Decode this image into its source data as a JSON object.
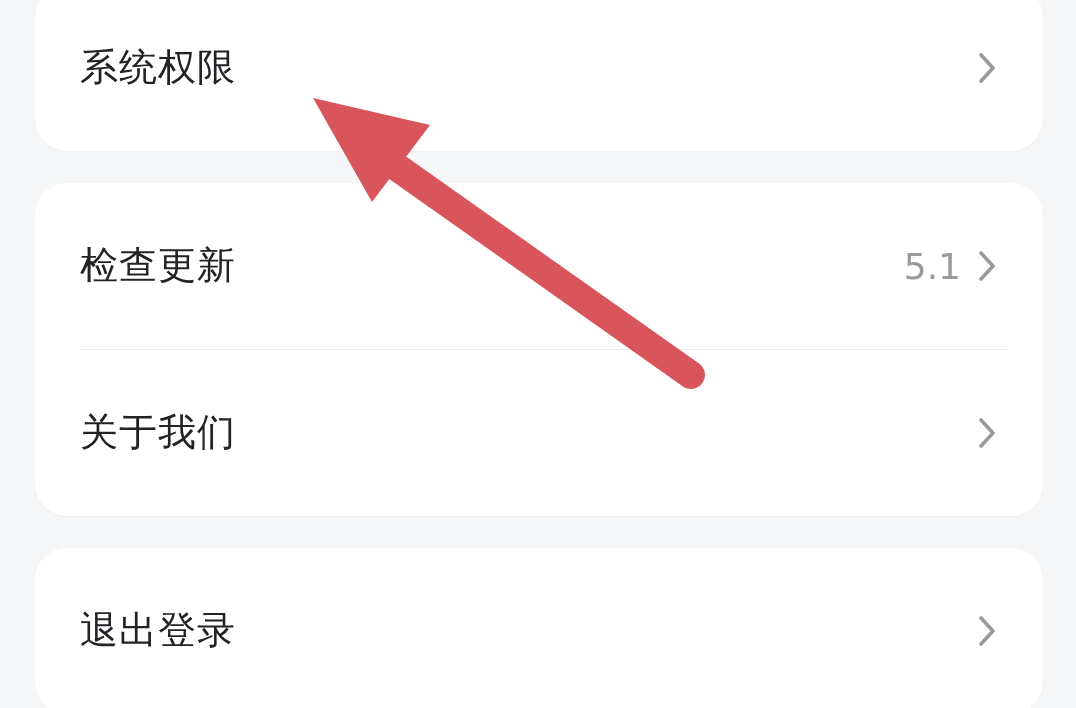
{
  "sections": [
    {
      "items": [
        {
          "label": "系统权限"
        }
      ]
    },
    {
      "items": [
        {
          "label": "检查更新",
          "value": "5.1"
        },
        {
          "label": "关于我们"
        }
      ]
    },
    {
      "items": [
        {
          "label": "退出登录"
        }
      ]
    }
  ]
}
